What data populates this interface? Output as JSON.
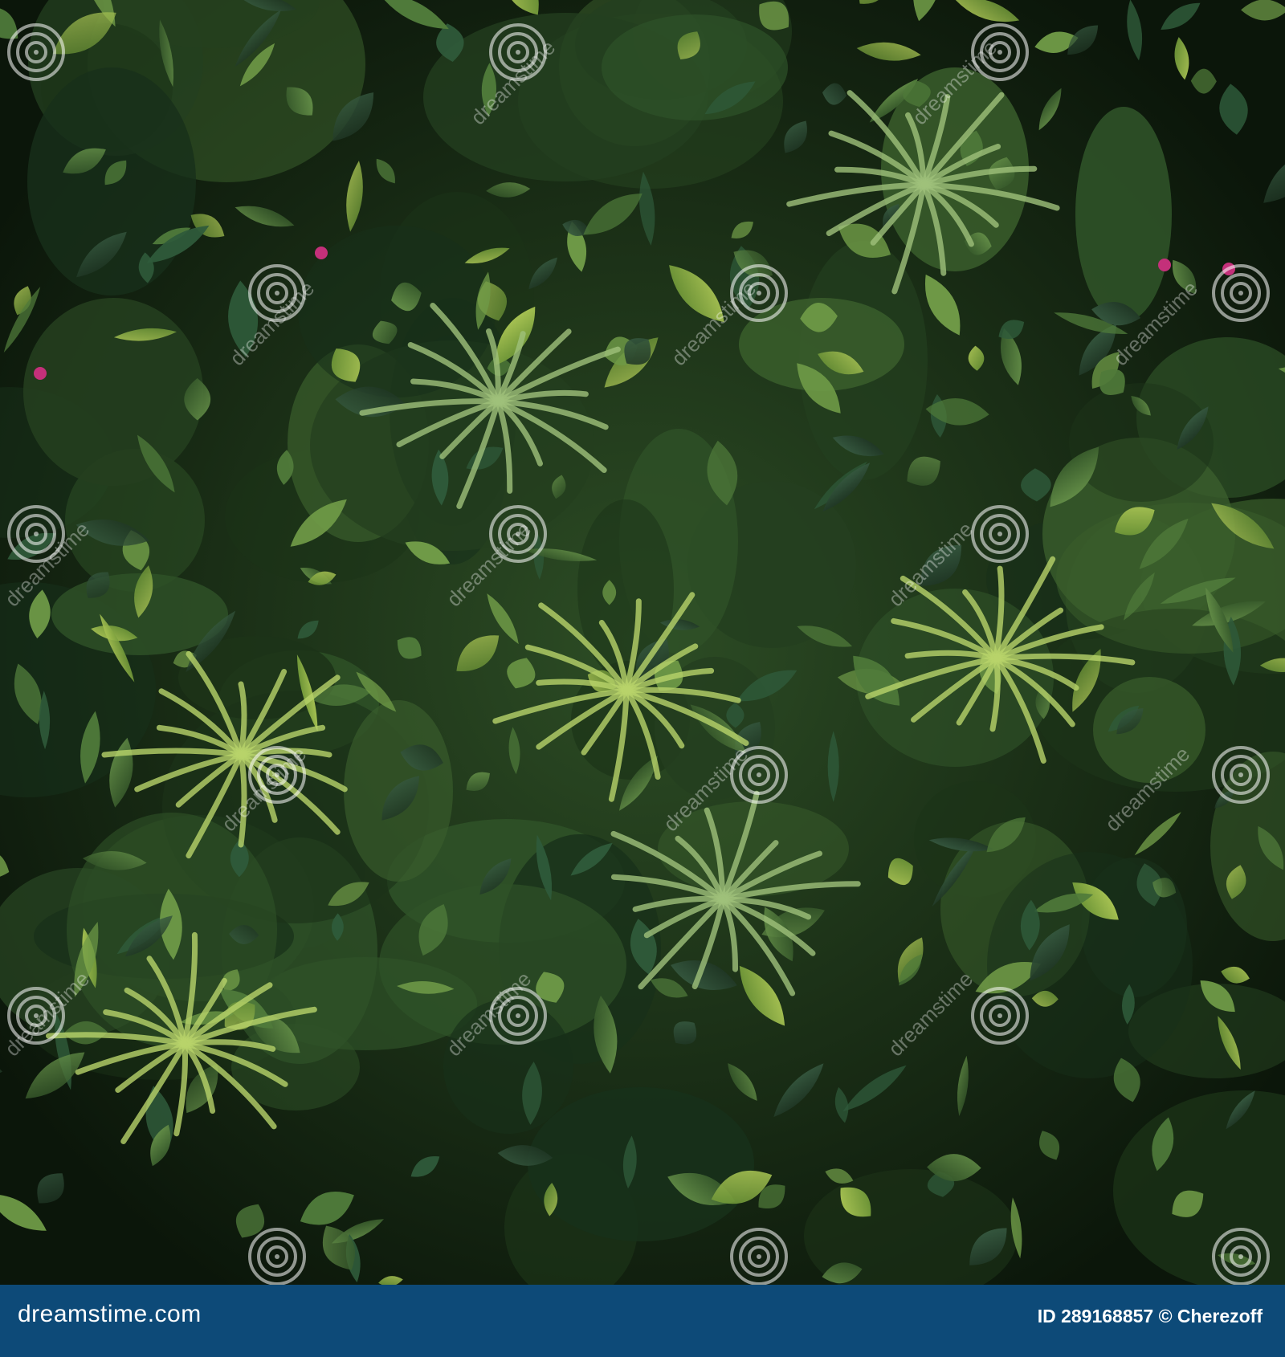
{
  "footer": {
    "brand": "dreamstime.com",
    "credit": "ID 289168857 © Cherezoff"
  },
  "watermark": {
    "text": "dreamstime"
  },
  "palette": {
    "footer_bg": "#0d4a78",
    "dark_bg": "#0c1a0a",
    "leaf_dark": "#1f3b1c",
    "leaf_mid": "#3f6b32",
    "leaf_light": "#8fb35a",
    "leaf_lime": "#c7d34a",
    "flower": "#c4307a"
  }
}
